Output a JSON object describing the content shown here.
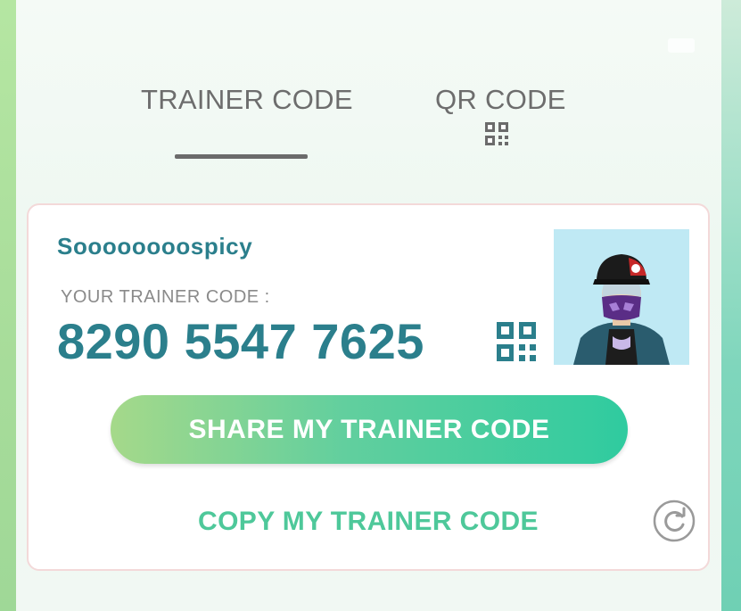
{
  "tabs": {
    "trainer_code": "TRAINER CODE",
    "qr_code": "QR CODE"
  },
  "card": {
    "username": "Soooooooospicy",
    "code_label": "YOUR TRAINER CODE :",
    "code_value": "8290 5547 7625",
    "share_label": "SHARE MY TRAINER CODE",
    "copy_label": "COPY MY TRAINER CODE"
  },
  "icons": {
    "tab_qr": "qr-code-icon",
    "card_qr": "qr-code-icon",
    "refresh": "refresh-icon",
    "avatar": "trainer-avatar"
  },
  "colors": {
    "accent_teal": "#2b7f8c",
    "accent_green": "#4ec89a",
    "tab_text": "#6d6d6d",
    "button_gradient_start": "#a5d98a",
    "button_gradient_end": "#2fcb9f"
  }
}
